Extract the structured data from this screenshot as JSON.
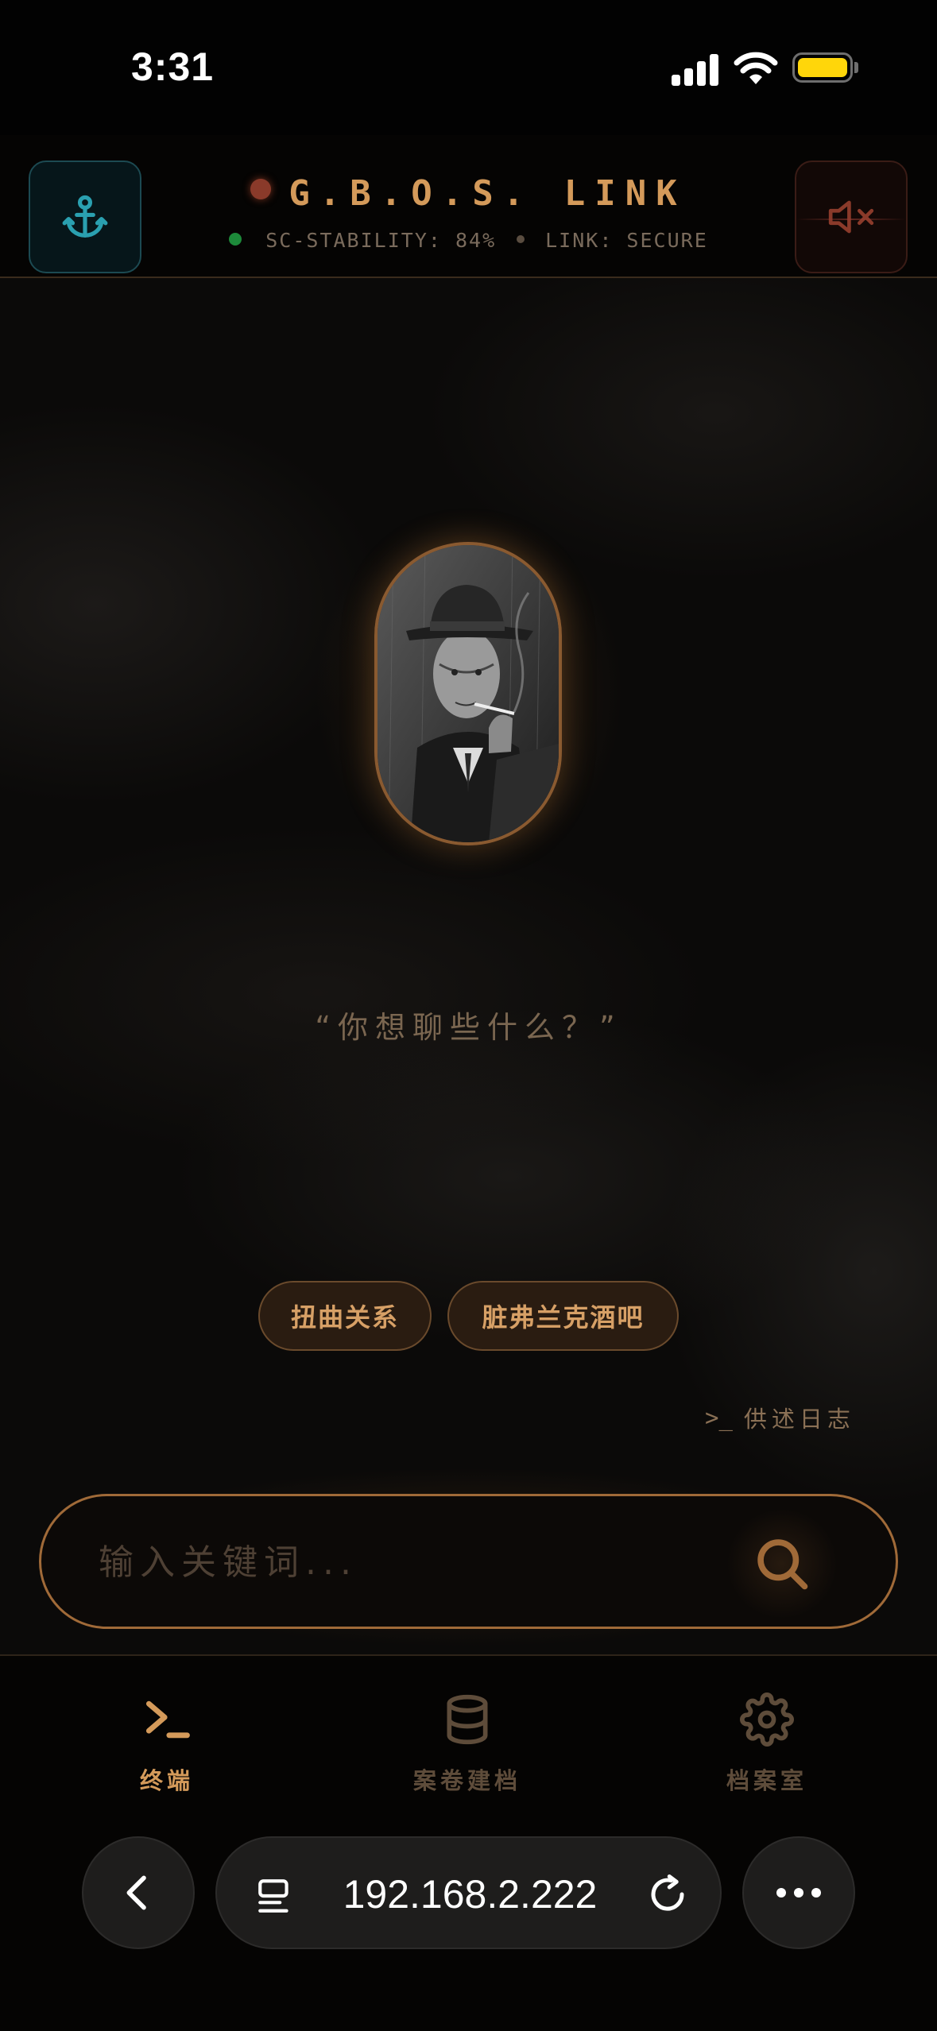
{
  "status_bar": {
    "time": "3:31"
  },
  "header": {
    "title": "G.B.O.S. LINK",
    "stability": "SC-STABILITY: 84%",
    "link_status": "LINK: SECURE"
  },
  "main": {
    "prompt_quote": "“你想聊些什么？”",
    "chips": [
      "扭曲关系",
      "脏弗兰克酒吧"
    ],
    "log_link": "供述日志",
    "log_icon": ">_"
  },
  "search": {
    "placeholder": "输入关键词..."
  },
  "nav": {
    "items": [
      {
        "label": "终端",
        "icon": "terminal-icon",
        "active": true
      },
      {
        "label": "案卷建档",
        "icon": "database-icon",
        "active": false
      },
      {
        "label": "档案室",
        "icon": "gear-icon",
        "active": false
      }
    ]
  },
  "browser": {
    "url": "192.168.2.222"
  },
  "colors": {
    "accent": "#d49a5a",
    "chip_bg": "#2a1c11",
    "anchor": "#2aa0b0",
    "mute": "#8a3a2a"
  }
}
